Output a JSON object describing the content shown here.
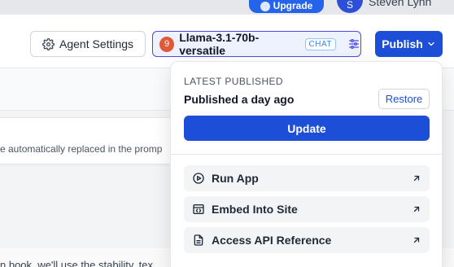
{
  "topbar": {
    "upgrade_label": "Upgrade",
    "user_initial": "S",
    "user_name": "Steven Lynn"
  },
  "header": {
    "agent_settings_label": "Agent Settings",
    "model": {
      "logo_glyph": "9",
      "name": "Llama-3.1-70b-versatile",
      "badge": "CHAT"
    },
    "publish_label": "Publish"
  },
  "background": {
    "hint_text": "e automatically replaced in the promp",
    "body_text": "n book, we'll use the stability, tex"
  },
  "publish_menu": {
    "section_label": "LATEST PUBLISHED",
    "status": "Published a day ago",
    "restore_label": "Restore",
    "update_label": "Update",
    "items": [
      {
        "label": "Run App",
        "icon": "play-circle-icon"
      },
      {
        "label": "Embed Into Site",
        "icon": "embed-icon"
      },
      {
        "label": "Access API Reference",
        "icon": "document-icon"
      }
    ]
  },
  "colors": {
    "primary": "#1d4ed8",
    "model_border": "#4f46e5",
    "model_logo": "#e05a3a"
  }
}
